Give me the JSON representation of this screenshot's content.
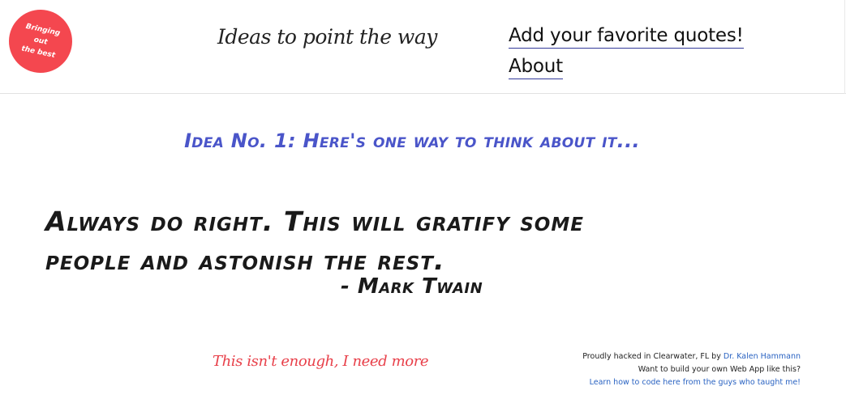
{
  "header": {
    "logo": {
      "line1": "Bringing",
      "line2": "out",
      "line3": "the best"
    },
    "tagline": "Ideas to point the way",
    "nav": [
      {
        "label": "Add your favorite quotes!"
      },
      {
        "label": "About"
      }
    ]
  },
  "main": {
    "idea_heading": "Idea No. 1: Here's one way to think about it...",
    "quote": {
      "line1": "Always do right. This will gratify some",
      "line2": "people and astonish the rest.",
      "author": "- Mark Twain"
    },
    "more_link": "This isn't enough, I need more"
  },
  "footer": {
    "credit_prefix": "Proudly hacked in Clearwater, FL by ",
    "credit_author": "Dr. Kalen Hammann",
    "cta_text": "Want to build your own Web App like this?",
    "cta_link": "Learn how to code here from the guys who taught me!"
  },
  "colors": {
    "logo_bg": "#f4474f",
    "heading_blue": "#4a55c9",
    "more_link_red": "#e8404a",
    "credit_link_blue": "#2a63c2"
  }
}
